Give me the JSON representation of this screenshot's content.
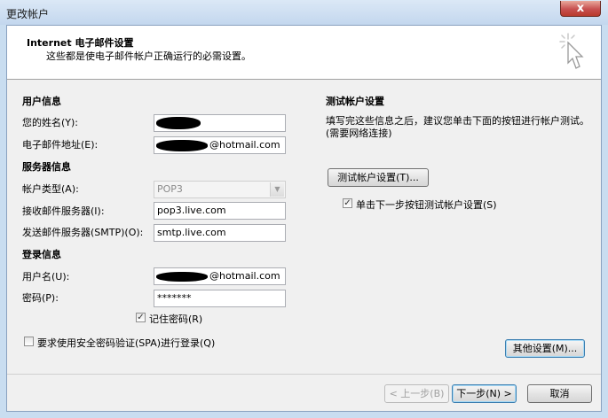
{
  "window": {
    "title": "更改帐户",
    "close_label": "x"
  },
  "header": {
    "title": "Internet 电子邮件设置",
    "subtitle": "这些都是使电子邮件帐户正确运行的必需设置。"
  },
  "user_info": {
    "section": "用户信息",
    "name_label": "您的姓名(Y):",
    "email_label": "电子邮件地址(E):",
    "email_value": "@hotmail.com"
  },
  "server_info": {
    "section": "服务器信息",
    "account_type_label": "帐户类型(A):",
    "account_type_value": "POP3",
    "incoming_label": "接收邮件服务器(I):",
    "incoming_value": "pop3.live.com",
    "outgoing_label": "发送邮件服务器(SMTP)(O):",
    "outgoing_value": "smtp.live.com"
  },
  "login_info": {
    "section": "登录信息",
    "username_label": "用户名(U):",
    "username_value": "@hotmail.com",
    "password_label": "密码(P):",
    "password_value": "*******",
    "remember_label": "记住密码(R)",
    "remember_checked": true,
    "spa_label": "要求使用安全密码验证(SPA)进行登录(Q)",
    "spa_checked": false
  },
  "test_settings": {
    "section": "测试帐户设置",
    "description": "填写完这些信息之后，建议您单击下面的按钮进行帐户测试。(需要网络连接)",
    "test_button": "测试帐户设置(T)...",
    "auto_test_label": "单击下一步按钮测试帐户设置(S)",
    "auto_test_checked": true
  },
  "buttons": {
    "more_settings": "其他设置(M)...",
    "back": "< 上一步(B)",
    "next": "下一步(N) >",
    "cancel": "取消"
  },
  "check_mark": "✓"
}
